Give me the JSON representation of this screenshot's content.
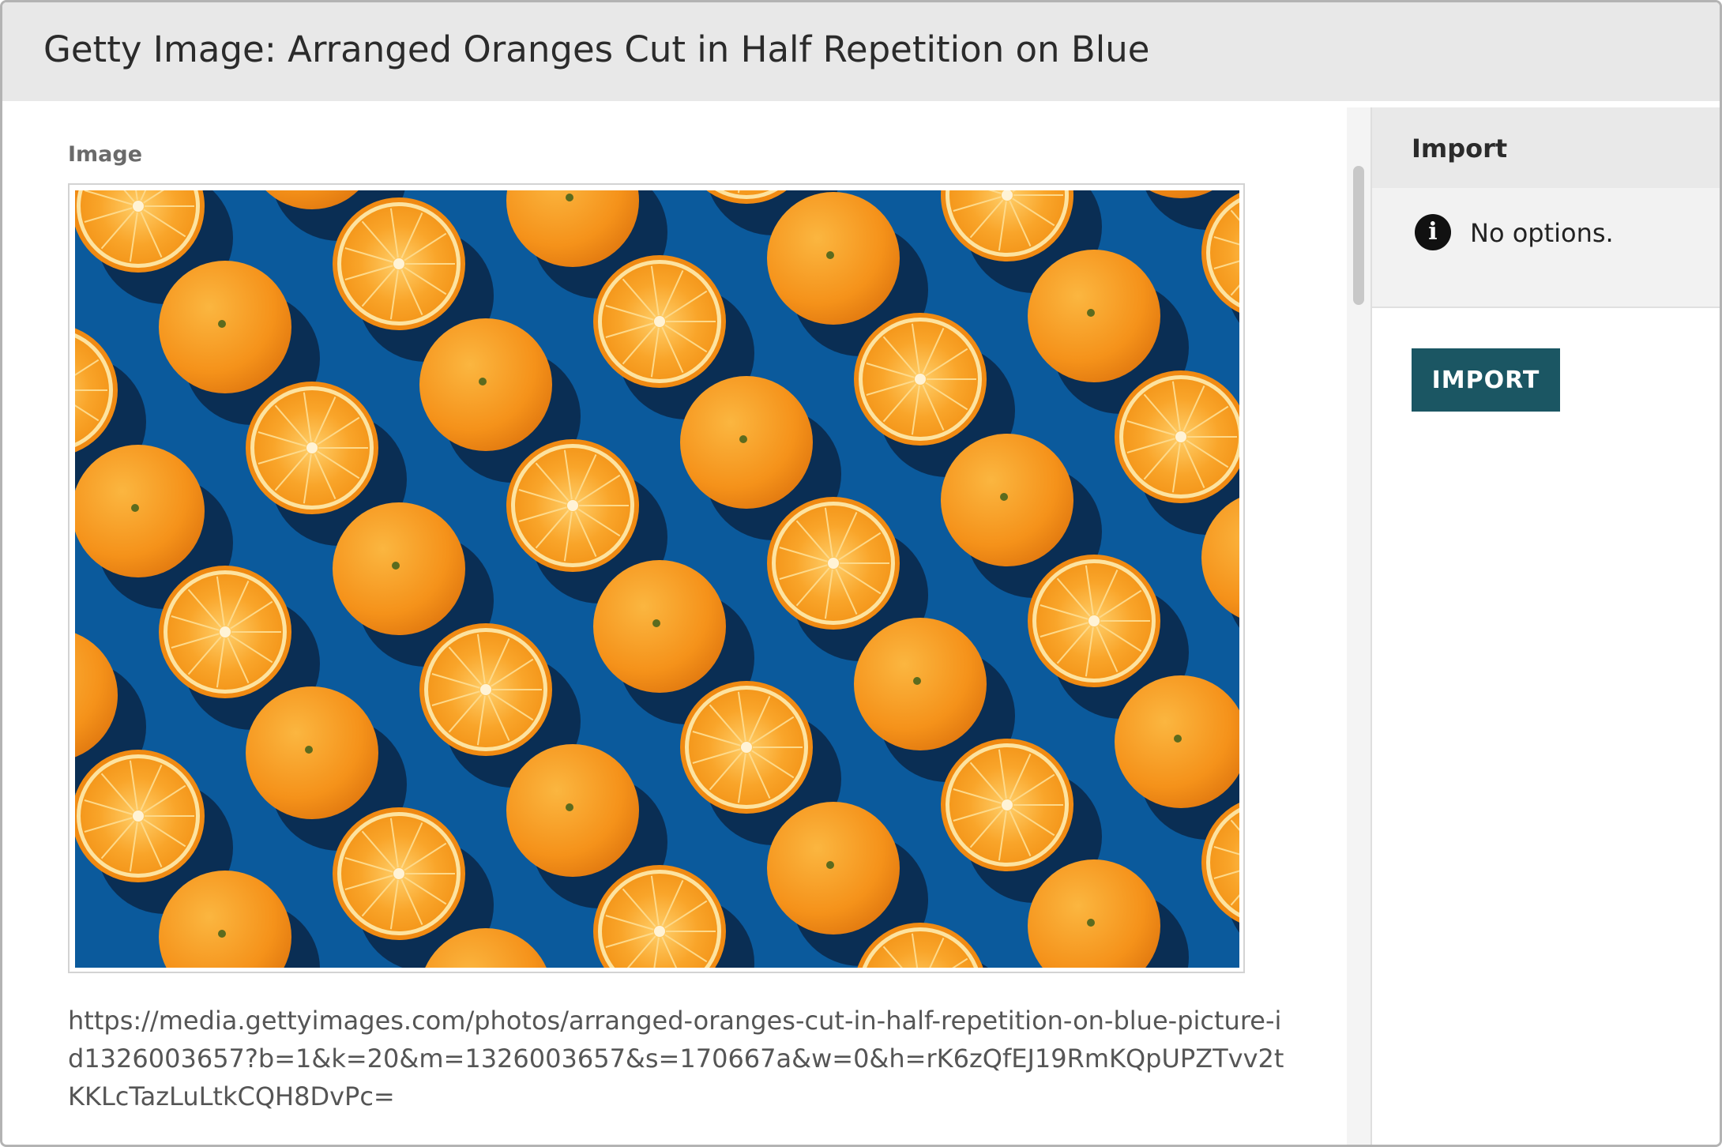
{
  "header": {
    "title": "Getty Image: Arranged Oranges Cut in Half Repetition on Blue"
  },
  "main": {
    "image_label": "Image",
    "image_description": "Oranges, whole and cut in half, in diagonal rows on a blue background",
    "url": "https://media.gettyimages.com/photos/arranged-oranges-cut-in-half-repetition-on-blue-picture-id1326003657?b=1&k=20&m=1326003657&s=170667a&w=0&h=rK6zQfEJ19RmKQpUPZTvv2tKKLcTazLuLtkCQH8DvPc="
  },
  "sidebar": {
    "title": "Import",
    "info_text": "No options.",
    "import_button": "IMPORT"
  },
  "colors": {
    "header_bg": "#e8e8e8",
    "button_bg": "#1b5663",
    "image_bg": "#0b5a9c",
    "orange_skin": "#f59a1e",
    "orange_flesh": "#f7a125"
  }
}
